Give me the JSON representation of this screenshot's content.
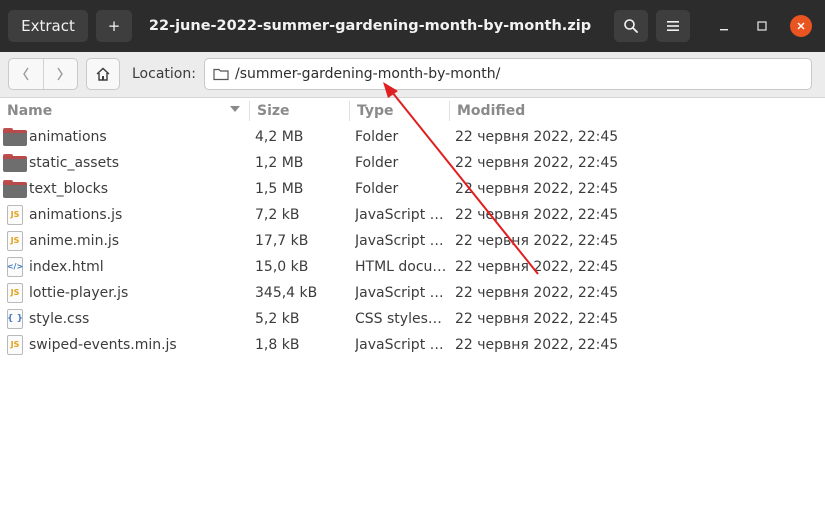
{
  "header": {
    "extract_label": "Extract",
    "add_symbol": "+",
    "title": "22-june-2022-summer-gardening-month-by-month.zip",
    "search_icon": "search-icon",
    "menu_icon": "hamburger-menu-icon",
    "minimize_icon": "minimize-icon",
    "maximize_icon": "maximize-icon",
    "close_icon": "close-icon",
    "close_color": "#e95420"
  },
  "location": {
    "label": "Location:",
    "path": "/summer-gardening-month-by-month/"
  },
  "columns": {
    "name": "Name",
    "size": "Size",
    "type": "Type",
    "modified": "Modified"
  },
  "files": [
    {
      "icon": "folder",
      "name": "animations",
      "size": "4,2 MB",
      "type": "Folder",
      "modified": "22 червня 2022, 22:45"
    },
    {
      "icon": "folder",
      "name": "static_assets",
      "size": "1,2 MB",
      "type": "Folder",
      "modified": "22 червня 2022, 22:45"
    },
    {
      "icon": "folder",
      "name": "text_blocks",
      "size": "1,5 MB",
      "type": "Folder",
      "modified": "22 червня 2022, 22:45"
    },
    {
      "icon": "js",
      "name": "animations.js",
      "size": "7,2 kB",
      "type": "JavaScript …",
      "modified": "22 червня 2022, 22:45"
    },
    {
      "icon": "js",
      "name": "anime.min.js",
      "size": "17,7 kB",
      "type": "JavaScript …",
      "modified": "22 червня 2022, 22:45"
    },
    {
      "icon": "html",
      "name": "index.html",
      "size": "15,0 kB",
      "type": "HTML docu…",
      "modified": "22 червня 2022, 22:45"
    },
    {
      "icon": "js",
      "name": "lottie-player.js",
      "size": "345,4 kB",
      "type": "JavaScript …",
      "modified": "22 червня 2022, 22:45"
    },
    {
      "icon": "css",
      "name": "style.css",
      "size": "5,2 kB",
      "type": "CSS stylesh…",
      "modified": "22 червня 2022, 22:45"
    },
    {
      "icon": "js",
      "name": "swiped-events.min.js",
      "size": "1,8 kB",
      "type": "JavaScript …",
      "modified": "22 червня 2022, 22:45"
    }
  ],
  "icon_glyphs": {
    "js": "JS",
    "html": "</>",
    "css": "{ }"
  },
  "annotation": {
    "color": "#e02020"
  }
}
